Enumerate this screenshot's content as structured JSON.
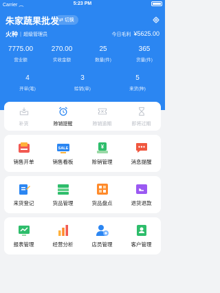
{
  "status_bar": {
    "carrier": "Carrier",
    "time": "5:23 PM"
  },
  "header": {
    "title": "朱家蔬果批发",
    "switch_label": "切换",
    "user_name": "火种",
    "role": "超级管理员",
    "gross_profit_label": "今日毛利",
    "gross_profit_value": "¥5625.00"
  },
  "stats_top": [
    {
      "value": "7775.00",
      "label": "营业额"
    },
    {
      "value": "270.00",
      "label": "实收金额"
    },
    {
      "value": "25",
      "label": "数量(件)"
    },
    {
      "value": "365",
      "label": "货量(件)"
    }
  ],
  "stats_bottom": [
    {
      "value": "4",
      "label": "开单(笔)"
    },
    {
      "value": "3",
      "label": "赊销(单)"
    },
    {
      "value": "5",
      "label": "来货(种)"
    }
  ],
  "tabs": [
    {
      "label": "补货",
      "icon": "inbox-icon"
    },
    {
      "label": "赊销提醒",
      "icon": "alarm-clock-icon"
    },
    {
      "label": "赊销逾期",
      "icon": "ticket-icon"
    },
    {
      "label": "即将过期",
      "icon": "hourglass-icon"
    }
  ],
  "grid1": [
    {
      "label": "销售开单",
      "icon": "sales-order-icon"
    },
    {
      "label": "销售看板",
      "icon": "sale-board-icon"
    },
    {
      "label": "赊销管理",
      "icon": "credit-icon"
    },
    {
      "label": "消息提醒",
      "icon": "message-icon"
    }
  ],
  "grid2": [
    {
      "label": "来货登记",
      "icon": "register-icon"
    },
    {
      "label": "货品管理",
      "icon": "goods-icon"
    },
    {
      "label": "货品盘点",
      "icon": "inventory-icon"
    },
    {
      "label": "退货退款",
      "icon": "refund-icon"
    }
  ],
  "grid3": [
    {
      "label": "报表管理",
      "icon": "report-icon"
    },
    {
      "label": "经营分析",
      "icon": "analysis-icon"
    },
    {
      "label": "店员管理",
      "icon": "staff-icon"
    },
    {
      "label": "客户管理",
      "icon": "customer-icon"
    }
  ],
  "colors": {
    "primary": "#2b86f2",
    "background": "#f2f3f5"
  }
}
